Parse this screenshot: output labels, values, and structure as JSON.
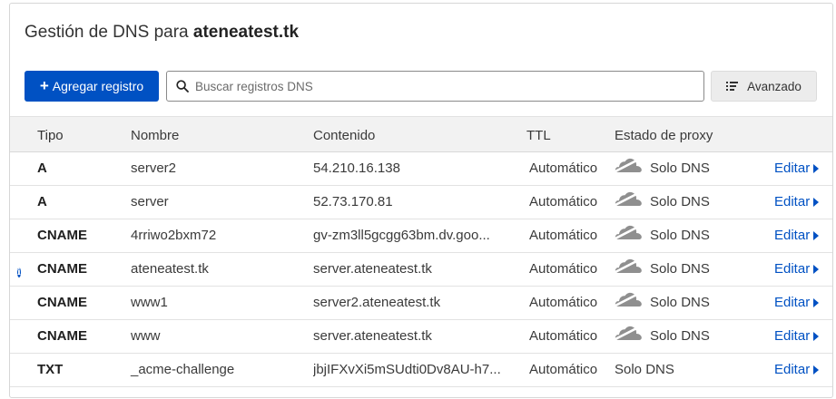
{
  "header": {
    "title_prefix": "Gestión de DNS para",
    "domain": "ateneatest.tk"
  },
  "toolbar": {
    "add_label": "Agregar registro",
    "search_placeholder": "Buscar registros DNS",
    "advanced_label": "Avanzado"
  },
  "table": {
    "columns": {
      "type": "Tipo",
      "name": "Nombre",
      "content": "Contenido",
      "ttl": "TTL",
      "proxy": "Estado de proxy"
    },
    "edit_label": "Editar",
    "rows": [
      {
        "type": "A",
        "name": "server2",
        "content": "54.210.16.138",
        "ttl": "Automático",
        "proxy": "Solo DNS",
        "proxy_icon": "cloud-dns-only-icon",
        "info": false
      },
      {
        "type": "A",
        "name": "server",
        "content": "52.73.170.81",
        "ttl": "Automático",
        "proxy": "Solo DNS",
        "proxy_icon": "cloud-dns-only-icon",
        "info": false
      },
      {
        "type": "CNAME",
        "name": "4rriwo2bxm72",
        "content": "gv-zm3ll5gcgg63bm.dv.goo...",
        "ttl": "Automático",
        "proxy": "Solo DNS",
        "proxy_icon": "cloud-dns-only-icon",
        "info": false
      },
      {
        "type": "CNAME",
        "name": "ateneatest.tk",
        "content": "server.ateneatest.tk",
        "ttl": "Automático",
        "proxy": "Solo DNS",
        "proxy_icon": "cloud-dns-only-icon",
        "info": true
      },
      {
        "type": "CNAME",
        "name": "www1",
        "content": "server2.ateneatest.tk",
        "ttl": "Automático",
        "proxy": "Solo DNS",
        "proxy_icon": "cloud-dns-only-icon",
        "info": false
      },
      {
        "type": "CNAME",
        "name": "www",
        "content": "server.ateneatest.tk",
        "ttl": "Automático",
        "proxy": "Solo DNS",
        "proxy_icon": "cloud-dns-only-icon",
        "info": false
      },
      {
        "type": "TXT",
        "name": "_acme-challenge",
        "content": "jbjIFXvXi5mSUdti0Dv8AU-h7...",
        "ttl": "Automático",
        "proxy": "Solo DNS",
        "proxy_icon": "",
        "info": false
      }
    ]
  },
  "colors": {
    "primary": "#0051c3",
    "header_bg": "#f2f2f2",
    "cloud_gray": "#8f8f8f"
  }
}
